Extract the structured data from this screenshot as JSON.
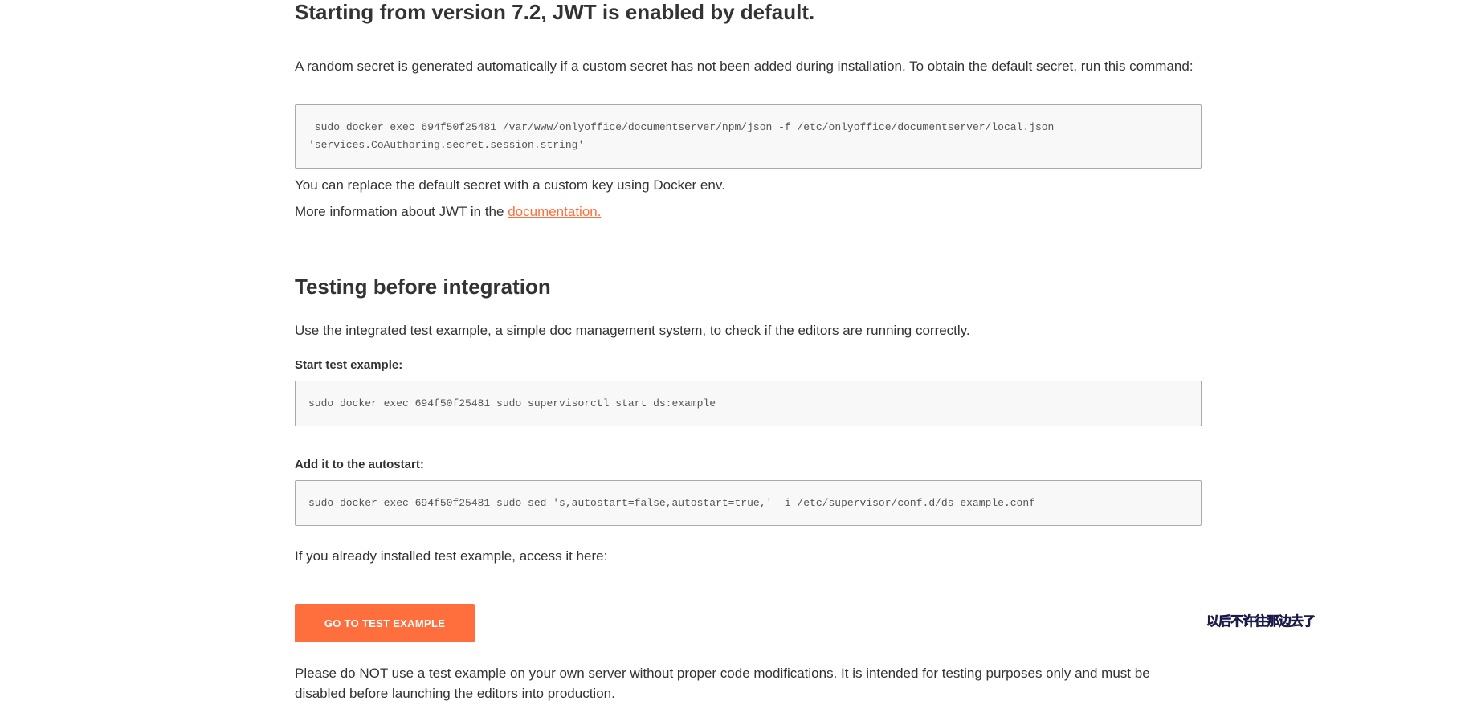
{
  "jwt_section": {
    "heading": "Starting from version 7.2, JWT is enabled by default.",
    "intro": "A random secret is generated automatically if a custom secret has not been added during installation. To obtain the default secret, run this command:",
    "command": " sudo docker exec 694f50f25481 /var/www/onlyoffice/documentserver/npm/json -f /etc/onlyoffice/documentserver/local.json\n'services.CoAuthoring.secret.session.string'",
    "replace_note": "You can replace the default secret with a custom key using Docker env.",
    "more_info_prefix": "More information about JWT in the ",
    "more_info_link": "documentation."
  },
  "testing_section": {
    "heading": "Testing before integration",
    "intro": "Use the integrated test example, a simple doc management system, to check if the editors are running correctly.",
    "start_label": "Start test example:",
    "start_command": "sudo docker exec 694f50f25481 sudo supervisorctl start ds:example",
    "autostart_label": "Add it to the autostart:",
    "autostart_command": "sudo docker exec 694f50f25481 sudo sed 's,autostart=false,autostart=true,' -i /etc/supervisor/conf.d/ds-example.conf",
    "access_note": "If you already installed test example, access it here:",
    "button_label": "GO TO TEST EXAMPLE",
    "warning": "Please do NOT use a test example on your own server without proper code modifications. It is intended for testing purposes only and must be disabled before launching the editors into production."
  },
  "overlay_text": "以后不许往那边去了",
  "colors": {
    "accent": "#ff6f3d",
    "text": "#333333",
    "code_bg": "#f8f8f8",
    "code_border": "#aaaaaa"
  }
}
